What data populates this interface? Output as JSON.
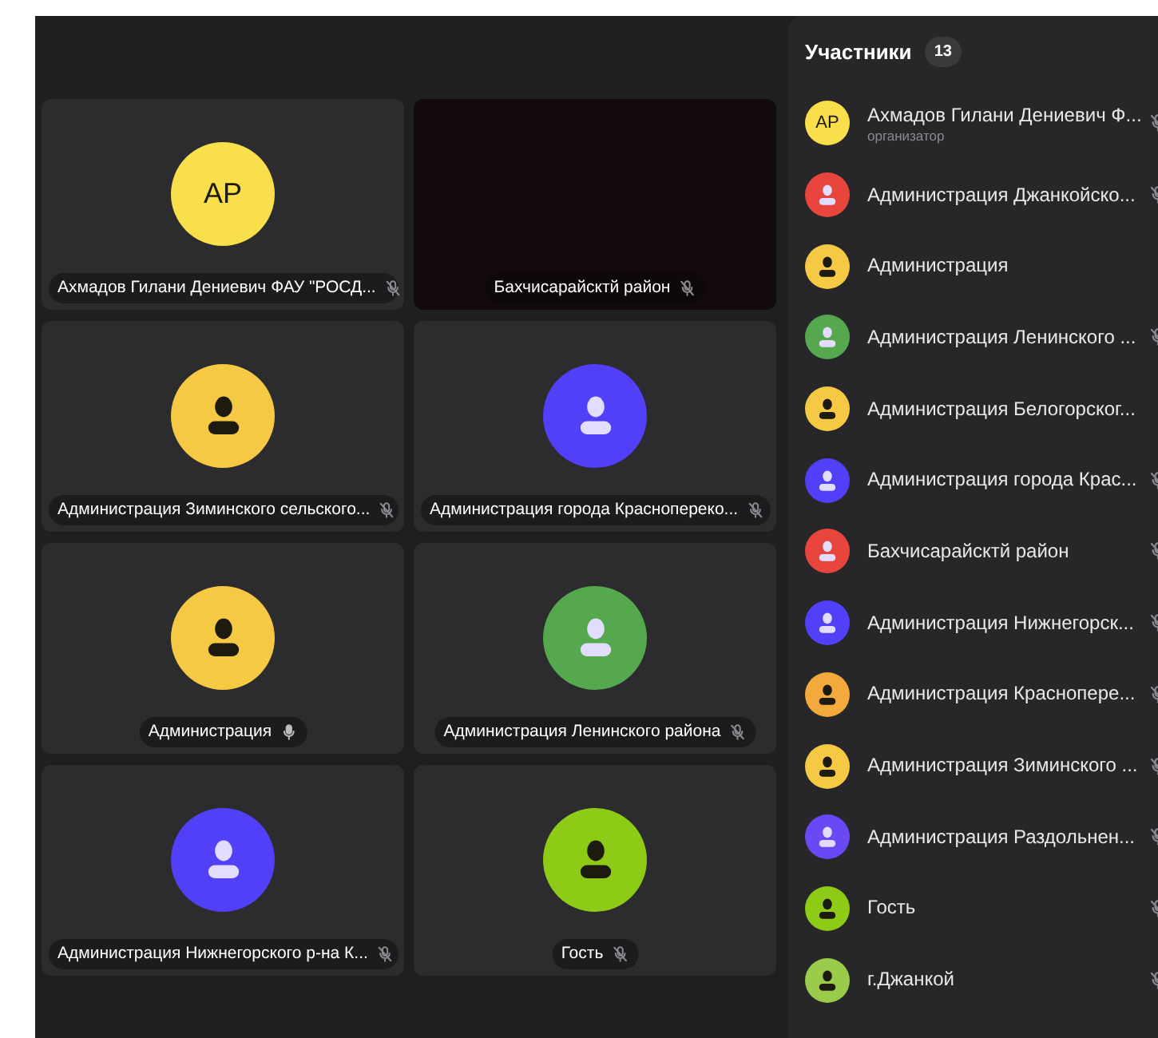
{
  "tiles": [
    {
      "kind": "initials",
      "initials": "AP",
      "color": "#f9df4b",
      "label": "Ахмадов Гилани Дениевич ФАУ \"РОСД...",
      "muted": true
    },
    {
      "kind": "video",
      "label": "Бахчисарайсктй район",
      "muted": true
    },
    {
      "kind": "person",
      "color": "#f6c944",
      "label": "Администрация Зиминского сельского...",
      "muted": true
    },
    {
      "kind": "person",
      "color": "#5140f7",
      "label": "Администрация города Краснопереко...",
      "muted": true
    },
    {
      "kind": "person",
      "color": "#f6c944",
      "label": "Администрация",
      "muted": false
    },
    {
      "kind": "person",
      "color": "#56a84f",
      "label": "Администрация Ленинского района",
      "muted": true
    },
    {
      "kind": "person",
      "color": "#5140f7",
      "label": "Администрация Нижнегорского р-на К...",
      "muted": true
    },
    {
      "kind": "person",
      "color": "#8dcb17",
      "label": "Гость",
      "muted": true
    }
  ],
  "participants": {
    "title": "Участники",
    "count": "13",
    "items": [
      {
        "kind": "initials",
        "initials": "AP",
        "color": "#f9df4b",
        "name": "Ахмадов Гилани Дениевич Ф...",
        "role": "организатор",
        "mic_shown": true,
        "muted": true
      },
      {
        "kind": "person",
        "color": "#e8463d",
        "name": "Администрация Джанкойско...",
        "mic_shown": true,
        "muted": true
      },
      {
        "kind": "person",
        "color": "#f6c944",
        "name": "Администрация",
        "mic_shown": false
      },
      {
        "kind": "person",
        "color": "#56a84f",
        "name": "Администрация Ленинского ...",
        "mic_shown": true,
        "muted": true
      },
      {
        "kind": "person",
        "color": "#f6c944",
        "name": "Администрация Белогорског...",
        "mic_shown": false
      },
      {
        "kind": "person",
        "color": "#5140f7",
        "name": "Администрация города Крас...",
        "mic_shown": true,
        "muted": true
      },
      {
        "kind": "person",
        "color": "#e8463d",
        "name": "Бахчисарайсктй район",
        "mic_shown": true,
        "muted": true
      },
      {
        "kind": "person",
        "color": "#5140f7",
        "name": "Администрация Нижнегорск...",
        "mic_shown": true,
        "muted": true
      },
      {
        "kind": "person",
        "color": "#f3a93b",
        "name": "Администрация Краснопере...",
        "mic_shown": true,
        "muted": true
      },
      {
        "kind": "person",
        "color": "#f6c944",
        "name": "Администрация Зиминского ...",
        "mic_shown": true,
        "muted": true
      },
      {
        "kind": "person",
        "color": "#6a48f5",
        "name": "Администрация Раздольнен...",
        "mic_shown": true,
        "muted": true
      },
      {
        "kind": "person",
        "color": "#8dcb17",
        "name": "Гость",
        "mic_shown": true,
        "muted": true
      },
      {
        "kind": "person",
        "color": "#9bcb4a",
        "name": "г.Джанкой",
        "mic_shown": true,
        "muted": true
      }
    ]
  }
}
